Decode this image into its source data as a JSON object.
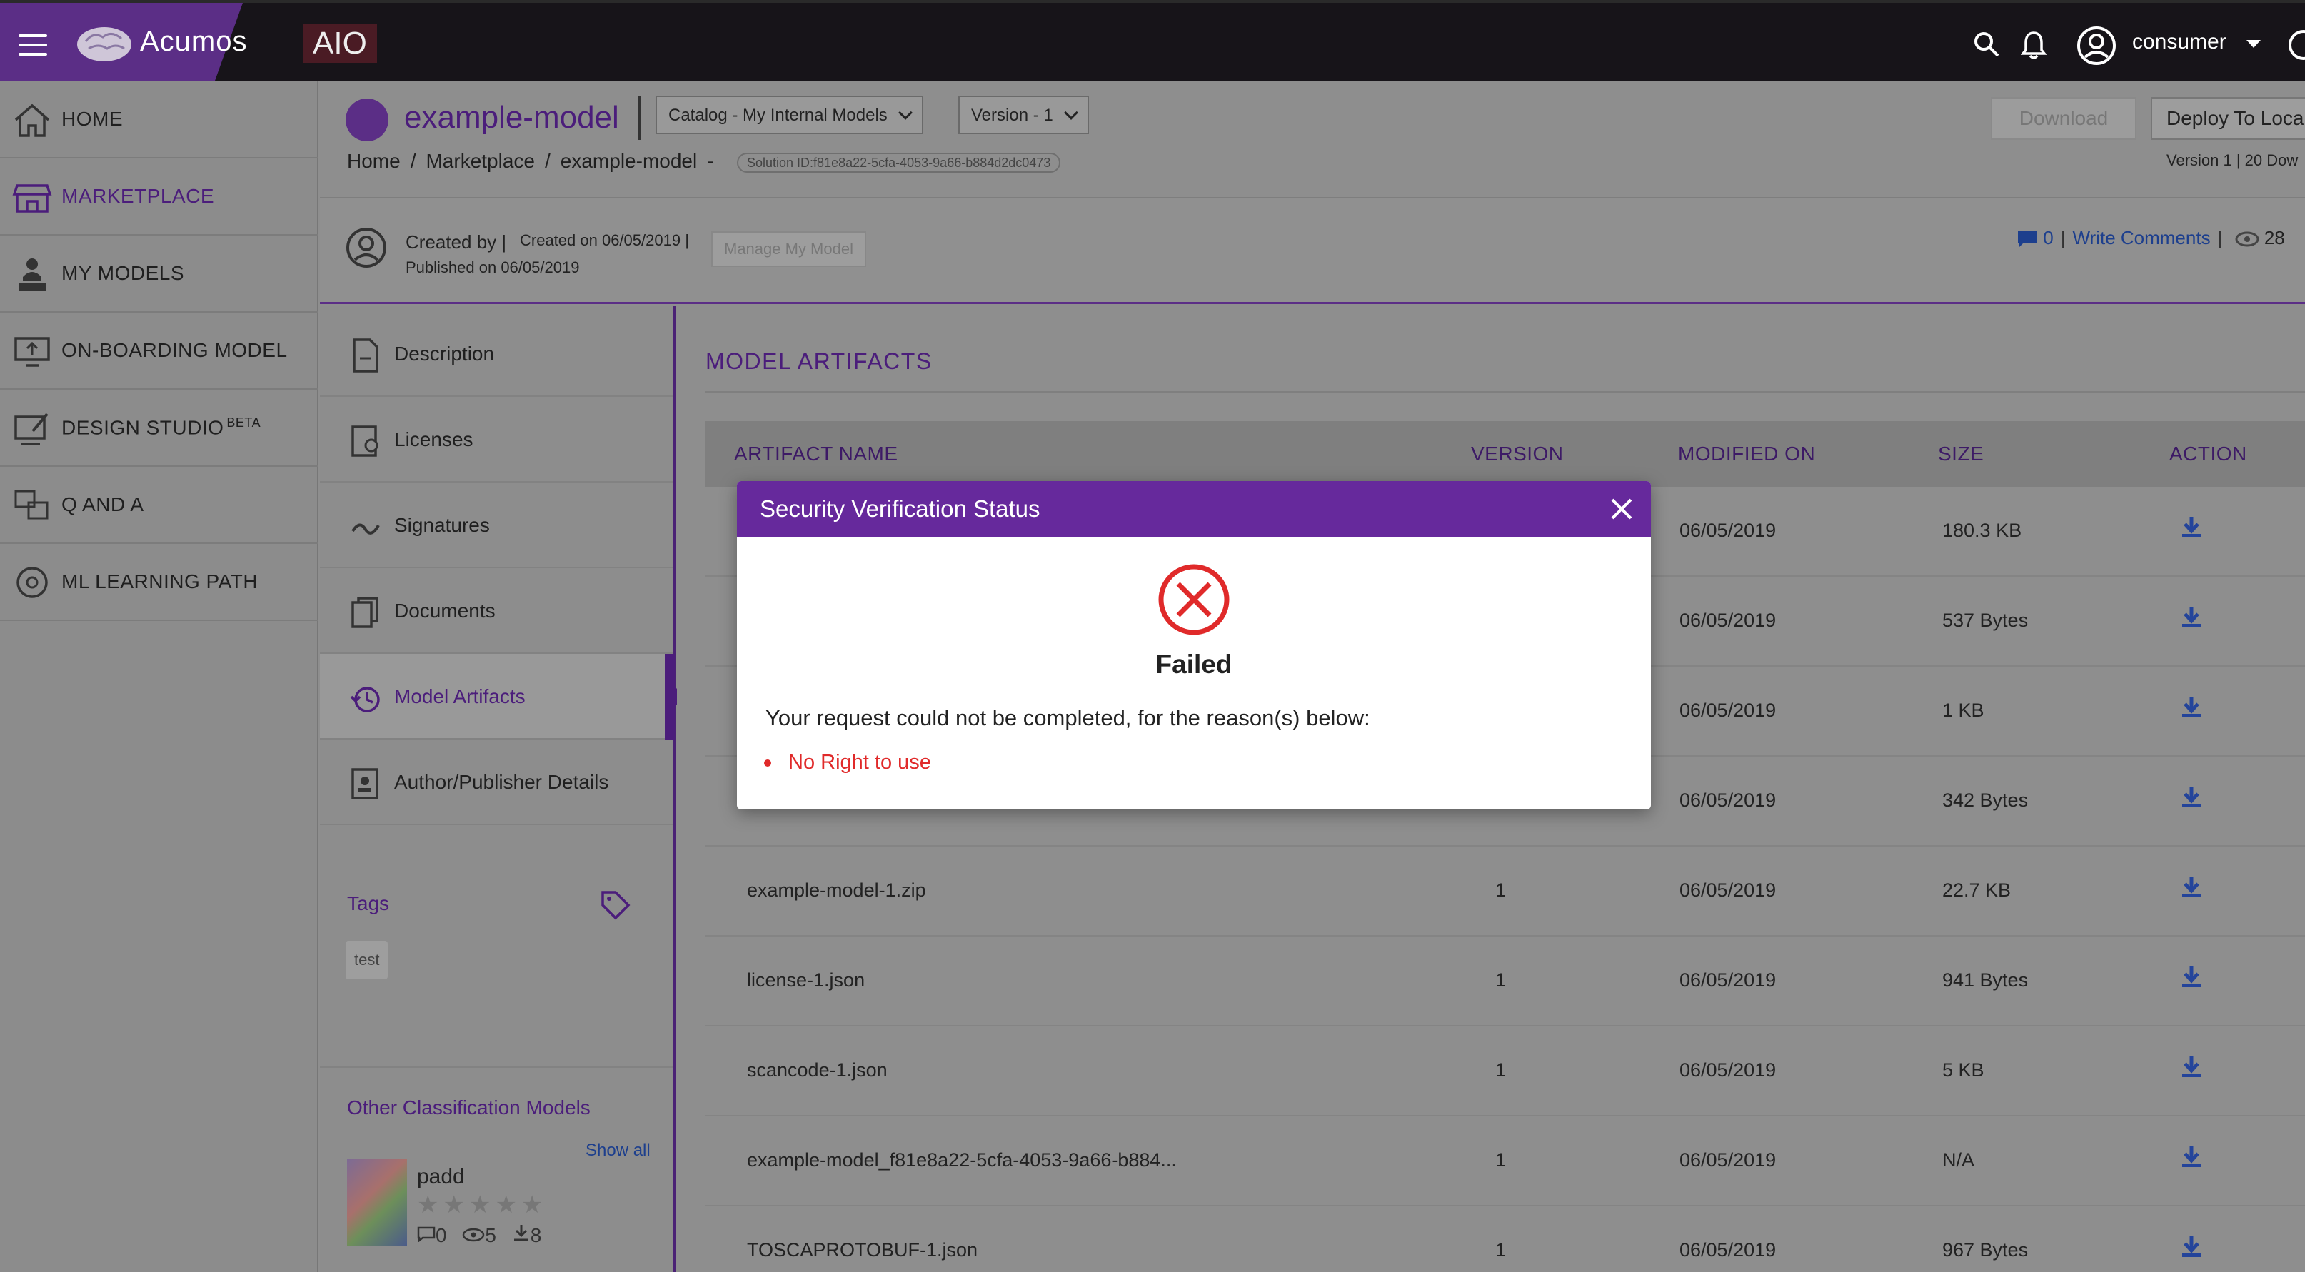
{
  "topbar": {
    "brand": "Acumos",
    "environment": "AIO",
    "user": "consumer",
    "icons": [
      "menu-icon",
      "search-icon",
      "bell-icon",
      "user-circle-icon",
      "chevron-down-icon",
      "help-icon"
    ]
  },
  "sidebar": {
    "items": [
      {
        "label": "HOME",
        "icon": "home-icon",
        "active": false
      },
      {
        "label": "MARKETPLACE",
        "icon": "storefront-icon",
        "active": true
      },
      {
        "label": "MY MODELS",
        "icon": "person-desk-icon",
        "active": false
      },
      {
        "label": "ON-BOARDING MODEL",
        "icon": "monitor-upload-icon",
        "active": false
      },
      {
        "label": "DESIGN STUDIO",
        "badge": "BETA",
        "icon": "design-board-icon",
        "active": false
      },
      {
        "label": "Q AND A",
        "icon": "qa-icon",
        "active": false
      },
      {
        "label": "ML LEARNING PATH",
        "icon": "brain-gear-icon",
        "active": false
      }
    ]
  },
  "header": {
    "model_name": "example-model",
    "catalog_select": "Catalog - My Internal Models",
    "version_select": "Version - 1",
    "download_label": "Download",
    "deploy_label": "Deploy To Loca",
    "version_info": "Version 1 | 20 Dow",
    "breadcrumb": [
      "Home",
      "Marketplace",
      "example-model"
    ],
    "breadcrumb_dash": "-",
    "solution_id": "Solution ID:f81e8a22-5cfa-4053-9a66-b884d2dc0473"
  },
  "meta": {
    "created_by": "Created by",
    "created_on": "Created on 06/05/2019",
    "published_on": "Published on 06/05/2019",
    "manage_label": "Manage My Model",
    "comment_count": "0",
    "write_comments": "Write Comments",
    "views": "28"
  },
  "tabs": [
    {
      "label": "Description",
      "icon": "document-icon",
      "active": false
    },
    {
      "label": "Licenses",
      "icon": "license-icon",
      "active": false
    },
    {
      "label": "Signatures",
      "icon": "signature-icon",
      "active": false
    },
    {
      "label": "Documents",
      "icon": "documents-icon",
      "active": false
    },
    {
      "label": "Model Artifacts",
      "icon": "history-icon",
      "active": true
    },
    {
      "label": "Author/Publisher Details",
      "icon": "author-icon",
      "active": false
    }
  ],
  "tags": {
    "title": "Tags",
    "items": [
      "test"
    ]
  },
  "other_models": {
    "title": "Other Classification Models",
    "show_all": "Show all",
    "items": [
      {
        "name": "padd",
        "rating": 0,
        "comments": "0",
        "views": "5",
        "downloads": "8"
      }
    ]
  },
  "artifacts": {
    "title": "MODEL ARTIFACTS",
    "columns": [
      "ARTIFACT NAME",
      "VERSION",
      "MODIFIED ON",
      "SIZE",
      "ACTION"
    ],
    "rows": [
      {
        "name": "",
        "version": "",
        "modified": "06/05/2019",
        "size": "180.3 KB"
      },
      {
        "name": "",
        "version": "",
        "modified": "06/05/2019",
        "size": "537 Bytes"
      },
      {
        "name": "",
        "version": "",
        "modified": "06/05/2019",
        "size": "1 KB"
      },
      {
        "name": "",
        "version": "",
        "modified": "06/05/2019",
        "size": "342 Bytes"
      },
      {
        "name": "example-model-1.zip",
        "version": "1",
        "modified": "06/05/2019",
        "size": "22.7 KB"
      },
      {
        "name": "license-1.json",
        "version": "1",
        "modified": "06/05/2019",
        "size": "941 Bytes"
      },
      {
        "name": "scancode-1.json",
        "version": "1",
        "modified": "06/05/2019",
        "size": "5 KB"
      },
      {
        "name": "example-model_f81e8a22-5cfa-4053-9a66-b884...",
        "version": "1",
        "modified": "06/05/2019",
        "size": "N/A"
      },
      {
        "name": "TOSCAPROTOBUF-1.json",
        "version": "1",
        "modified": "06/05/2019",
        "size": "967 Bytes"
      }
    ]
  },
  "modal": {
    "title": "Security Verification Status",
    "status": "Failed",
    "message": "Your request could not be completed, for the reason(s) below:",
    "reasons": [
      "No Right to use"
    ]
  },
  "colors": {
    "brand_purple": "#5b2e86",
    "modal_header": "#66299c",
    "error_red": "#e02a2a",
    "link_blue": "#1d3f8d"
  }
}
